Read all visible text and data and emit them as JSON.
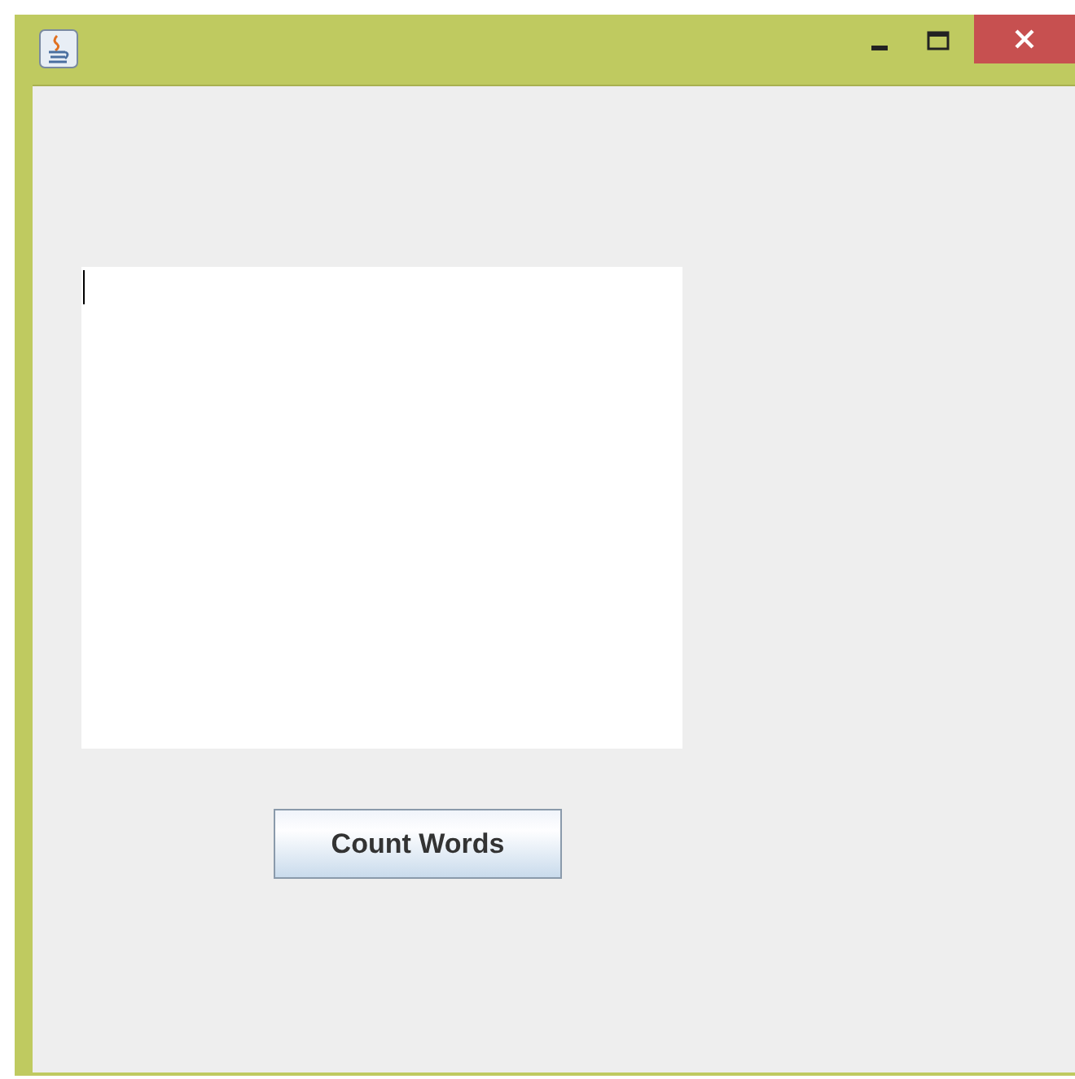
{
  "text_area": {
    "focused": true
  },
  "button": {
    "label": "Count Words"
  }
}
